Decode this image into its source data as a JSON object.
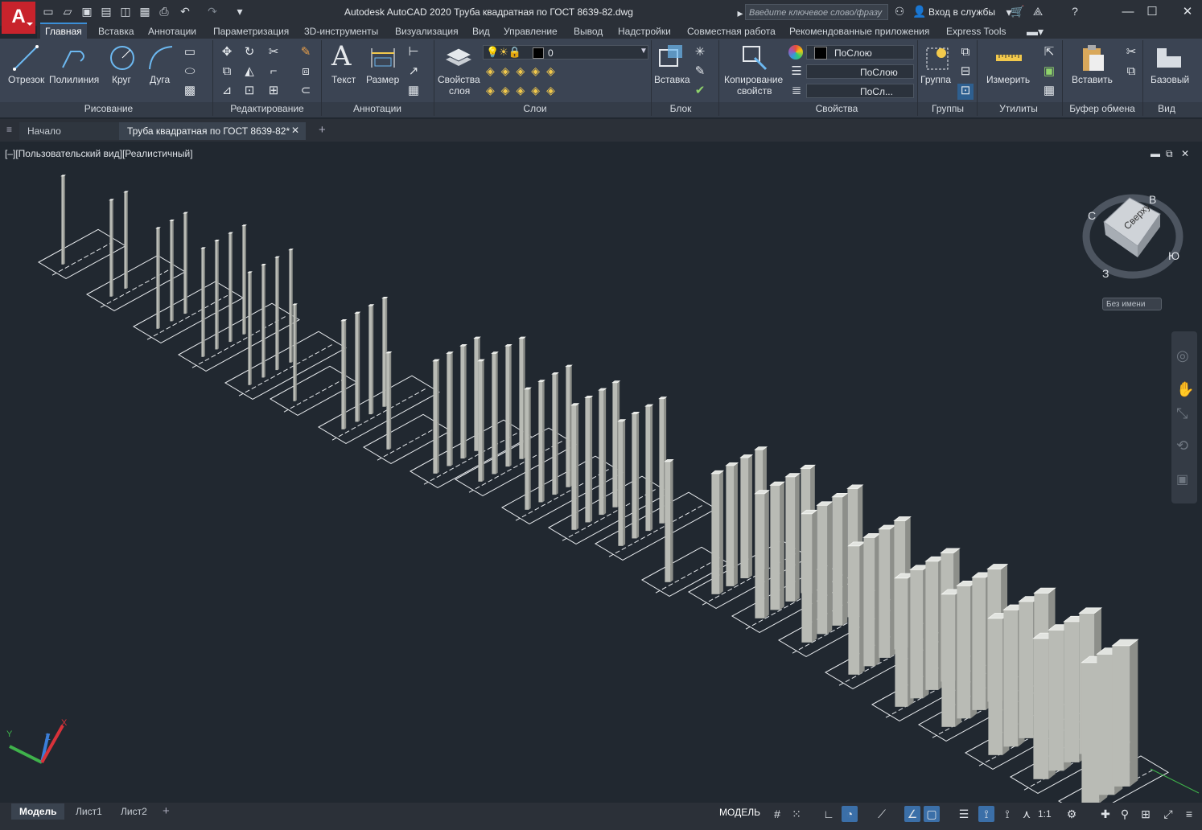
{
  "app": {
    "logo": "A",
    "title": "Autodesk AutoCAD 2020    Труба квадратная по ГОСТ 8639-82.dwg"
  },
  "quick_access": [
    "new-icon",
    "open-icon",
    "save-icon",
    "saveas-icon",
    "plot-preview-icon",
    "publish-icon",
    "print-icon",
    "undo-icon",
    "redo-icon",
    "customize-icon"
  ],
  "search": {
    "placeholder": "Введите ключевое слово/фразу"
  },
  "account": {
    "signin": "Вход в службы"
  },
  "ribbon_tabs": [
    "Главная",
    "Вставка",
    "Аннотации",
    "Параметризация",
    "3D-инструменты",
    "Визуализация",
    "Вид",
    "Управление",
    "Вывод",
    "Надстройки",
    "Совместная работа",
    "Рекомендованные приложения",
    "Express Tools"
  ],
  "draw": {
    "line": "Отрезок",
    "polyline": "Полилиния",
    "circle": "Круг",
    "arc": "Дуга",
    "title": "Рисование"
  },
  "modify": {
    "title": "Редактирование"
  },
  "annotation": {
    "text": "Текст",
    "dim": "Размер",
    "title": "Аннотации"
  },
  "layers": {
    "props_line1": "Свойства",
    "props_line2": "слоя",
    "current": "0",
    "title": "Слои"
  },
  "block": {
    "insert": "Вставка",
    "title": "Блок"
  },
  "properties": {
    "match_line1": "Копирование",
    "match_line2": "свойств",
    "color": "ПоСлою",
    "linetype": "ПоСлою",
    "lineweight": "ПоСл...",
    "title": "Свойства"
  },
  "groups": {
    "group": "Группа",
    "title": "Группы"
  },
  "utilities": {
    "measure": "Измерить",
    "title": "Утилиты"
  },
  "clipboard": {
    "paste": "Вставить",
    "title": "Буфер обмена"
  },
  "view": {
    "base": "Базовый",
    "title": "Вид"
  },
  "doc_tabs": {
    "start": "Начало",
    "file": "Труба квадратная по ГОСТ 8639-82*"
  },
  "viewport": {
    "label": "[–][Пользовательский вид][Реалистичный]"
  },
  "viewcube": {
    "face": "Сверху",
    "n": "С",
    "e": "В",
    "w": "З",
    "s": "Ю",
    "ucs": "Без имени"
  },
  "layout_tabs": [
    "Модель",
    "Лист1",
    "Лист2"
  ],
  "status": {
    "model": "МОДЕЛЬ",
    "scale": "1:1"
  }
}
